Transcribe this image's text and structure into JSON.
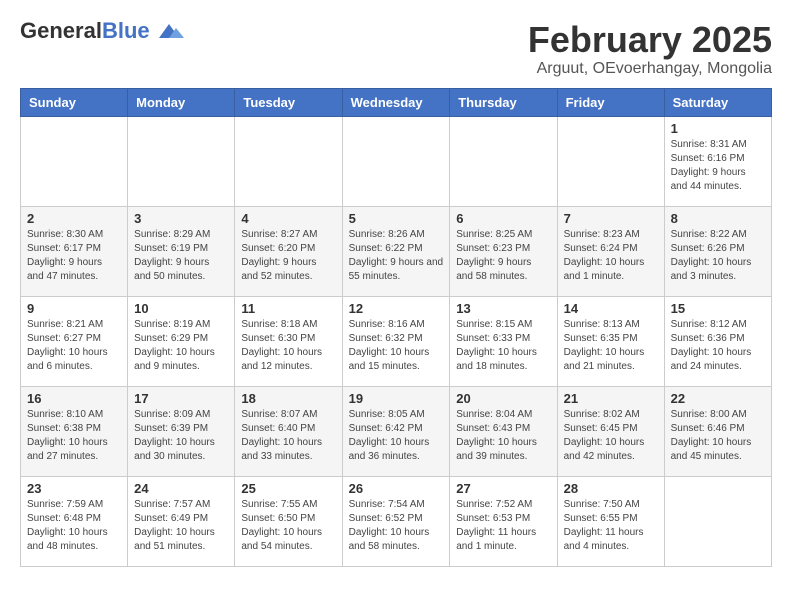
{
  "logo": {
    "general": "General",
    "blue": "Blue"
  },
  "title": {
    "month_year": "February 2025",
    "location": "Arguut, OEvoerhangay, Mongolia"
  },
  "days_of_week": [
    "Sunday",
    "Monday",
    "Tuesday",
    "Wednesday",
    "Thursday",
    "Friday",
    "Saturday"
  ],
  "weeks": [
    [
      {
        "day": "",
        "info": ""
      },
      {
        "day": "",
        "info": ""
      },
      {
        "day": "",
        "info": ""
      },
      {
        "day": "",
        "info": ""
      },
      {
        "day": "",
        "info": ""
      },
      {
        "day": "",
        "info": ""
      },
      {
        "day": "1",
        "info": "Sunrise: 8:31 AM\nSunset: 6:16 PM\nDaylight: 9 hours and 44 minutes."
      }
    ],
    [
      {
        "day": "2",
        "info": "Sunrise: 8:30 AM\nSunset: 6:17 PM\nDaylight: 9 hours and 47 minutes."
      },
      {
        "day": "3",
        "info": "Sunrise: 8:29 AM\nSunset: 6:19 PM\nDaylight: 9 hours and 50 minutes."
      },
      {
        "day": "4",
        "info": "Sunrise: 8:27 AM\nSunset: 6:20 PM\nDaylight: 9 hours and 52 minutes."
      },
      {
        "day": "5",
        "info": "Sunrise: 8:26 AM\nSunset: 6:22 PM\nDaylight: 9 hours and 55 minutes."
      },
      {
        "day": "6",
        "info": "Sunrise: 8:25 AM\nSunset: 6:23 PM\nDaylight: 9 hours and 58 minutes."
      },
      {
        "day": "7",
        "info": "Sunrise: 8:23 AM\nSunset: 6:24 PM\nDaylight: 10 hours and 1 minute."
      },
      {
        "day": "8",
        "info": "Sunrise: 8:22 AM\nSunset: 6:26 PM\nDaylight: 10 hours and 3 minutes."
      }
    ],
    [
      {
        "day": "9",
        "info": "Sunrise: 8:21 AM\nSunset: 6:27 PM\nDaylight: 10 hours and 6 minutes."
      },
      {
        "day": "10",
        "info": "Sunrise: 8:19 AM\nSunset: 6:29 PM\nDaylight: 10 hours and 9 minutes."
      },
      {
        "day": "11",
        "info": "Sunrise: 8:18 AM\nSunset: 6:30 PM\nDaylight: 10 hours and 12 minutes."
      },
      {
        "day": "12",
        "info": "Sunrise: 8:16 AM\nSunset: 6:32 PM\nDaylight: 10 hours and 15 minutes."
      },
      {
        "day": "13",
        "info": "Sunrise: 8:15 AM\nSunset: 6:33 PM\nDaylight: 10 hours and 18 minutes."
      },
      {
        "day": "14",
        "info": "Sunrise: 8:13 AM\nSunset: 6:35 PM\nDaylight: 10 hours and 21 minutes."
      },
      {
        "day": "15",
        "info": "Sunrise: 8:12 AM\nSunset: 6:36 PM\nDaylight: 10 hours and 24 minutes."
      }
    ],
    [
      {
        "day": "16",
        "info": "Sunrise: 8:10 AM\nSunset: 6:38 PM\nDaylight: 10 hours and 27 minutes."
      },
      {
        "day": "17",
        "info": "Sunrise: 8:09 AM\nSunset: 6:39 PM\nDaylight: 10 hours and 30 minutes."
      },
      {
        "day": "18",
        "info": "Sunrise: 8:07 AM\nSunset: 6:40 PM\nDaylight: 10 hours and 33 minutes."
      },
      {
        "day": "19",
        "info": "Sunrise: 8:05 AM\nSunset: 6:42 PM\nDaylight: 10 hours and 36 minutes."
      },
      {
        "day": "20",
        "info": "Sunrise: 8:04 AM\nSunset: 6:43 PM\nDaylight: 10 hours and 39 minutes."
      },
      {
        "day": "21",
        "info": "Sunrise: 8:02 AM\nSunset: 6:45 PM\nDaylight: 10 hours and 42 minutes."
      },
      {
        "day": "22",
        "info": "Sunrise: 8:00 AM\nSunset: 6:46 PM\nDaylight: 10 hours and 45 minutes."
      }
    ],
    [
      {
        "day": "23",
        "info": "Sunrise: 7:59 AM\nSunset: 6:48 PM\nDaylight: 10 hours and 48 minutes."
      },
      {
        "day": "24",
        "info": "Sunrise: 7:57 AM\nSunset: 6:49 PM\nDaylight: 10 hours and 51 minutes."
      },
      {
        "day": "25",
        "info": "Sunrise: 7:55 AM\nSunset: 6:50 PM\nDaylight: 10 hours and 54 minutes."
      },
      {
        "day": "26",
        "info": "Sunrise: 7:54 AM\nSunset: 6:52 PM\nDaylight: 10 hours and 58 minutes."
      },
      {
        "day": "27",
        "info": "Sunrise: 7:52 AM\nSunset: 6:53 PM\nDaylight: 11 hours and 1 minute."
      },
      {
        "day": "28",
        "info": "Sunrise: 7:50 AM\nSunset: 6:55 PM\nDaylight: 11 hours and 4 minutes."
      },
      {
        "day": "",
        "info": ""
      }
    ]
  ]
}
